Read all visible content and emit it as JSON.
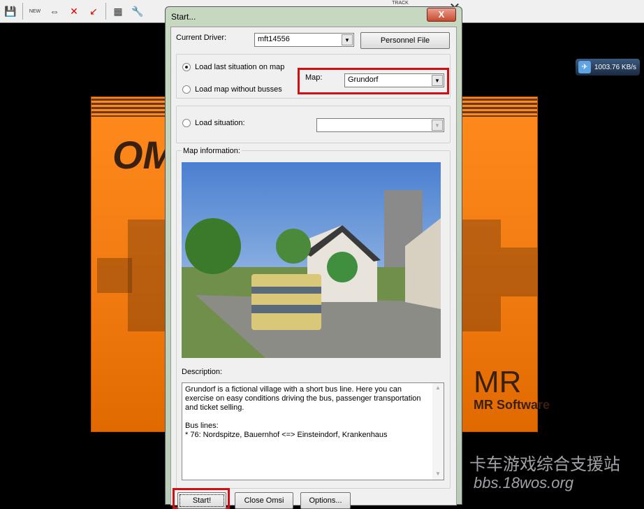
{
  "toolbar": {
    "icons": [
      "save-icon",
      "new-bus-icon",
      "swap-bus-icon",
      "delete-bus-icon",
      "pointer-icon",
      "calendar-icon",
      "wrench-icon"
    ],
    "labels": {
      "new": "NEW",
      "track": "TRACK"
    }
  },
  "network": {
    "speed": "1003.76 KB/s"
  },
  "background": {
    "logo": "OMSI",
    "publisher": "MR Software"
  },
  "dialog": {
    "title": "Start...",
    "close_label": "X",
    "current_driver_label": "Current Driver:",
    "current_driver_value": "mft14556",
    "personnel_file_button": "Personnel File",
    "radio_load_last": "Load last situation on map",
    "radio_load_no_busses": "Load map without busses",
    "map_label": "Map:",
    "map_value": "Grundorf",
    "radio_load_situation": "Load situation:",
    "situation_value": "",
    "map_info_label": "Map information:",
    "description_label": "Description:",
    "description_text": "Grundorf is a fictional village with a short bus line. Here you can exercise on easy conditions driving the bus, passenger transportation and ticket selling.\n\nBus lines:\n* 76: Nordspitze, Bauernhof <=> Einsteindorf, Krankenhaus",
    "start_button": "Start!",
    "close_omsi_button": "Close Omsi",
    "options_button": "Options..."
  },
  "watermark": {
    "line1": "卡车游戏综合支援站",
    "line2": "bbs.18wos.org"
  },
  "colors": {
    "highlight": "#d01010",
    "splash": "#ff8a1c"
  }
}
